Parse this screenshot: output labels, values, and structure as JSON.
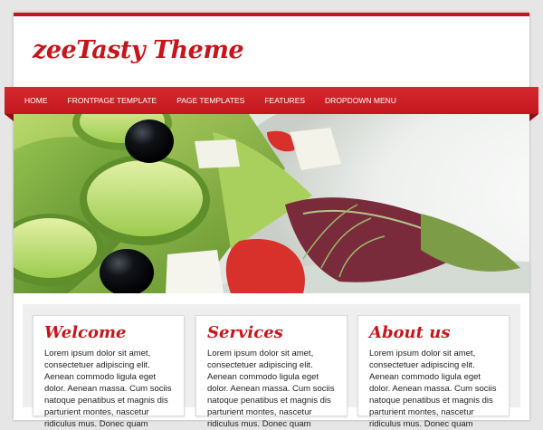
{
  "site": {
    "title": "zeeTasty Theme",
    "accent_color": "#c4161c"
  },
  "nav": {
    "items": [
      {
        "label": "HOME"
      },
      {
        "label": "FRONTPAGE TEMPLATE"
      },
      {
        "label": "PAGE TEMPLATES"
      },
      {
        "label": "FEATURES"
      },
      {
        "label": "DROPDOWN MENU"
      }
    ]
  },
  "hero": {
    "image": "salad-photo"
  },
  "boxes": [
    {
      "title": "Welcome",
      "text": "Lorem ipsum dolor sit amet, consectetuer adipiscing elit. Aenean commodo ligula eget dolor. Aenean massa. Cum sociis natoque penatibus et magnis dis parturient montes, nascetur ridiculus mus. Donec quam"
    },
    {
      "title": "Services",
      "text": "Lorem ipsum dolor sit amet, consectetuer adipiscing elit. Aenean commodo ligula eget dolor. Aenean massa. Cum sociis natoque penatibus et magnis dis parturient montes, nascetur ridiculus mus. Donec quam"
    },
    {
      "title": "About us",
      "text": "Lorem ipsum dolor sit amet, consectetuer adipiscing elit. Aenean commodo ligula eget dolor. Aenean massa. Cum sociis natoque penatibus et magnis dis parturient montes, nascetur ridiculus mus. Donec quam"
    }
  ]
}
